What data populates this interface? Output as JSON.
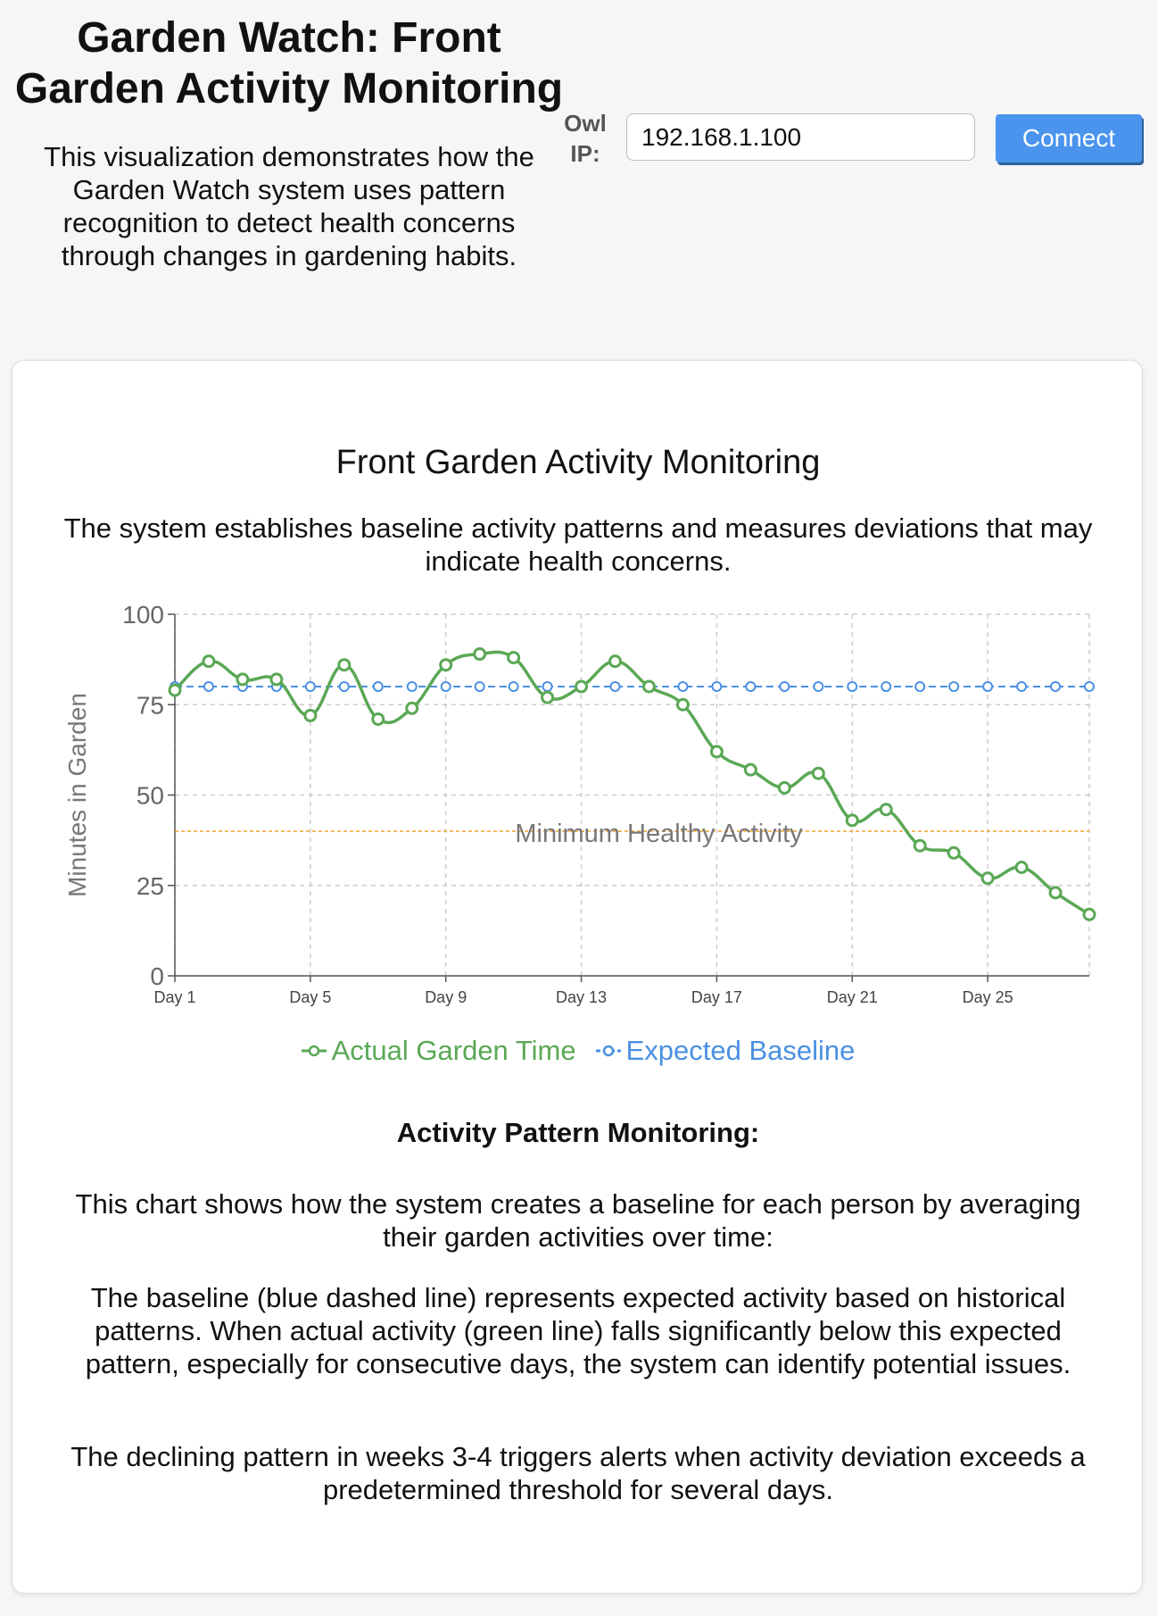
{
  "header": {
    "title": "Garden Watch: Front Garden Activity Monitoring",
    "intro": "This visualization demonstrates how the Garden Watch system uses pattern recognition to detect health concerns through changes in gardening habits.",
    "ip_label": "Owl IP:",
    "ip_value": "192.168.1.100",
    "connect_label": "Connect"
  },
  "card": {
    "chart_title": "Front Garden Activity Monitoring",
    "chart_desc": "The system establishes baseline activity patterns and measures deviations that may indicate health concerns.",
    "monitor_heading": "Activity Pattern Monitoring:",
    "paragraphs": [
      "This chart shows how the system creates a baseline for each person by averaging their garden activities over time:",
      "The baseline (blue dashed line) represents expected activity based on historical patterns. When actual activity (green line) falls significantly below this expected pattern, especially for consecutive days, the system can identify potential issues.",
      "The declining pattern in weeks 3-4 triggers alerts when activity deviation exceeds a predetermined threshold for several days."
    ]
  },
  "colors": {
    "actual": "#5aa855",
    "baseline": "#4a90e2",
    "threshold": "#f0a030",
    "grid": "#cccccc"
  },
  "chart_data": {
    "type": "line",
    "ylabel": "Minutes in Garden",
    "ylim": [
      0,
      100
    ],
    "yticks": [
      0,
      25,
      50,
      75,
      100
    ],
    "xtick_labels": [
      "Day 1",
      "Day 5",
      "Day 9",
      "Day 13",
      "Day 17",
      "Day 21",
      "Day 25"
    ],
    "x": [
      1,
      2,
      3,
      4,
      5,
      6,
      7,
      8,
      9,
      10,
      11,
      12,
      13,
      14,
      15,
      16,
      17,
      18,
      19,
      20,
      21,
      22,
      23,
      24,
      25,
      26,
      27,
      28
    ],
    "series": [
      {
        "name": "Actual Garden Time",
        "values": [
          79,
          87,
          82,
          82,
          72,
          86,
          71,
          74,
          86,
          89,
          88,
          77,
          80,
          87,
          80,
          75,
          62,
          57,
          52,
          56,
          43,
          46,
          36,
          34,
          27,
          30,
          23,
          17
        ]
      },
      {
        "name": "Expected Baseline",
        "values": [
          80,
          80,
          80,
          80,
          80,
          80,
          80,
          80,
          80,
          80,
          80,
          80,
          80,
          80,
          80,
          80,
          80,
          80,
          80,
          80,
          80,
          80,
          80,
          80,
          80,
          80,
          80,
          80
        ]
      }
    ],
    "threshold": {
      "label": "Minimum Healthy Activity",
      "value": 40
    },
    "grid": true,
    "legend": "bottom"
  }
}
